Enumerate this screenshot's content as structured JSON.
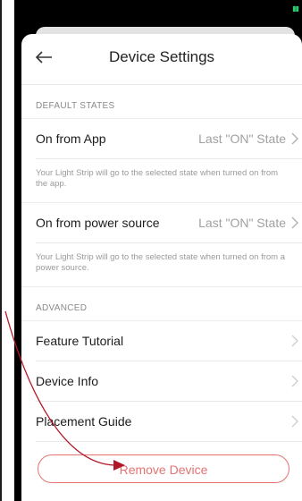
{
  "status_bar": {
    "battery_icon": "battery-charging-icon",
    "accent_color": "#2ecc71"
  },
  "header": {
    "title": "Device Settings",
    "back_icon": "back-arrow-icon"
  },
  "default_states": {
    "section_label": "DEFAULT STATES",
    "rows": [
      {
        "label": "On from App",
        "value": "Last \"ON\" State",
        "helper": "Your Light Strip will go to the selected state when turned on from the app."
      },
      {
        "label": "On from power source",
        "value": "Last \"ON\" State",
        "helper": "Your Light Strip will go to the selected state when turned on from a power source."
      }
    ]
  },
  "advanced": {
    "section_label": "ADVANCED",
    "rows": [
      {
        "label": "Feature Tutorial"
      },
      {
        "label": "Device Info"
      },
      {
        "label": "Placement Guide"
      }
    ]
  },
  "remove_device": {
    "label": "Remove Device",
    "color": "#e57373"
  },
  "annotation": {
    "color": "#b0182a"
  }
}
